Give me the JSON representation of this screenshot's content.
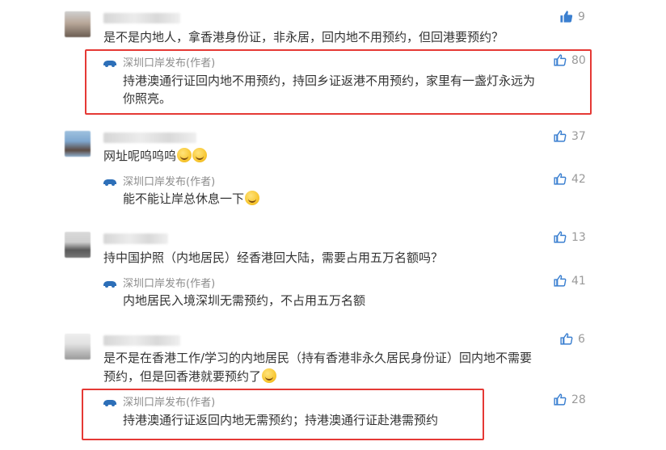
{
  "colors": {
    "highlight_border": "#e53935",
    "like_icon": "#3a7fd0",
    "text": "#333333",
    "muted": "#8c8c8c"
  },
  "comments": [
    {
      "text": "是不是内地人，拿香港身份证，非永居，回内地不用预约，但回港要预约？",
      "likes": "9",
      "reply": {
        "author": "深圳口岸发布(作者)",
        "line1": "持港澳通行证回内地不用预约，持回乡证返港不用预约，家里有一盏灯永远为",
        "line2": "你照亮。",
        "likes": "80"
      }
    },
    {
      "text": "网址呢呜呜呜",
      "likes": "37",
      "reply": {
        "author": "深圳口岸发布(作者)",
        "line1": "能不能让岸总休息一下",
        "likes": "42"
      }
    },
    {
      "text": "持中国护照（内地居民）经香港回大陆，需要占用五万名额吗？",
      "likes": "13",
      "reply": {
        "author": "深圳口岸发布(作者)",
        "line1": "内地居民入境深圳无需预约，不占用五万名额",
        "likes": "41"
      }
    },
    {
      "line1": "是不是在香港工作/学习的内地居民（持有香港非永久居民身份证）回内地不需要",
      "line2": "预约，但是回香港就要预约了",
      "likes": "6",
      "reply": {
        "author": "深圳口岸发布(作者)",
        "line1": "持港澳通行证返回内地无需预约；持港澳通行证赴港需预约",
        "likes": "28"
      }
    }
  ]
}
